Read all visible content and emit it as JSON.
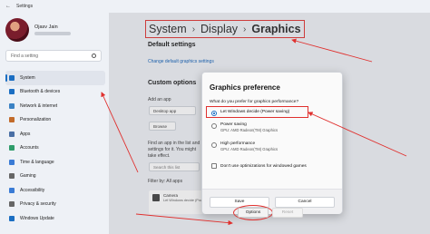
{
  "window": {
    "title": "Settings"
  },
  "profile": {
    "name": "Ojasv Jain"
  },
  "search": {
    "placeholder": "Find a setting"
  },
  "sidebar": {
    "items": [
      {
        "label": "System",
        "color": "#1b6ec2"
      },
      {
        "label": "Bluetooth & devices",
        "color": "#1b6ec2"
      },
      {
        "label": "Network & internet",
        "color": "#3b82c4"
      },
      {
        "label": "Personalization",
        "color": "#c26b2a"
      },
      {
        "label": "Apps",
        "color": "#4a6fa5"
      },
      {
        "label": "Accounts",
        "color": "#2e9c6a"
      },
      {
        "label": "Time & language",
        "color": "#3a7bd5"
      },
      {
        "label": "Gaming",
        "color": "#666666"
      },
      {
        "label": "Accessibility",
        "color": "#3a7bd5"
      },
      {
        "label": "Privacy & security",
        "color": "#666666"
      },
      {
        "label": "Windows Update",
        "color": "#1b6ec2"
      }
    ]
  },
  "breadcrumb": {
    "part1": "System",
    "part2": "Display",
    "current": "Graphics",
    "sep": "›"
  },
  "main": {
    "default_settings_title": "Default settings",
    "default_settings_link": "Change default graphics settings",
    "custom_options_title": "Custom options",
    "add_app_label": "Add an app",
    "app_type_value": "Desktop app",
    "browse_label": "Browse",
    "find_app_text": "Find an app in the list and",
    "settings_for_text": "settings for it. You might",
    "take_effect_text": "take effect.",
    "search_list_text": "Search this list",
    "filter_by_text": "Filter by: All apps",
    "app_name": "Camera",
    "app_sub": "Let Windows decide (Power saving)",
    "options_label": "Options",
    "reset_label": "Reset"
  },
  "dialog": {
    "title": "Graphics preference",
    "question": "What do you prefer for graphics performance?",
    "options": [
      {
        "label": "Let Windows decide (Power saving)",
        "sub": "",
        "selected": true
      },
      {
        "label": "Power saving",
        "sub": "GPU: AMD Radeon(TM) Graphics",
        "selected": false
      },
      {
        "label": "High performance",
        "sub": "GPU: AMD Radeon(TM) Graphics",
        "selected": false
      }
    ],
    "checkbox_label": "Don't use optimizations for windowed games",
    "save_label": "Save",
    "cancel_label": "Cancel"
  },
  "colors": {
    "accent": "#1b6ec2",
    "annotation": "#e0302e"
  }
}
